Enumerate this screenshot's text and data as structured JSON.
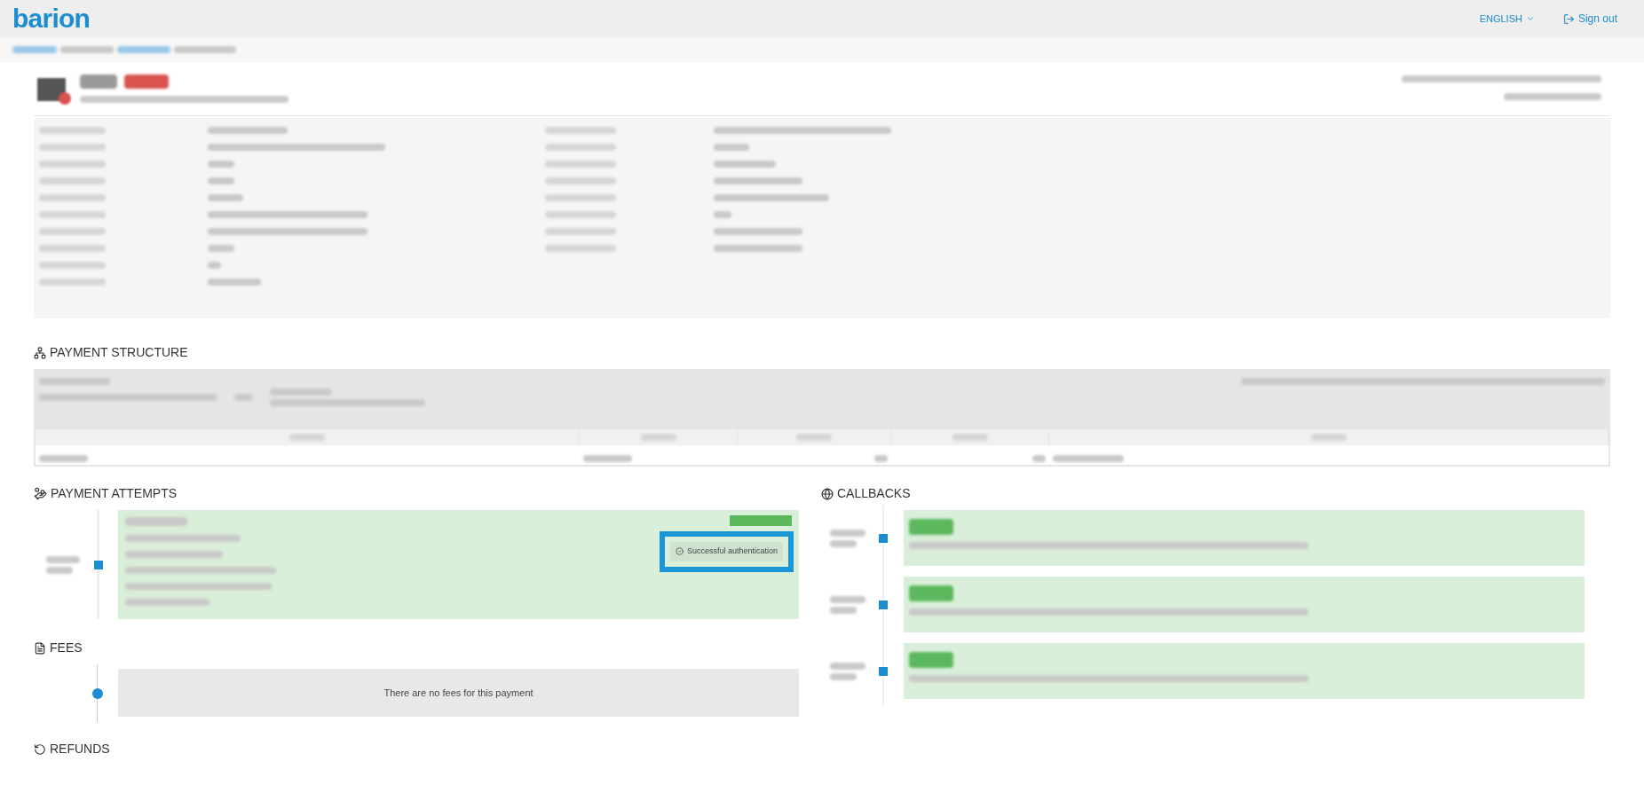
{
  "header": {
    "logo": "barion",
    "language": "ENGLISH",
    "sign_out": "Sign out"
  },
  "payment_structure": {
    "title": "PAYMENT STRUCTURE"
  },
  "payment_attempts": {
    "title": "PAYMENT ATTEMPTS",
    "attempts": [
      {
        "auth_status": "Successful authentication",
        "highlighted": true
      }
    ]
  },
  "callbacks": {
    "title": "CALLBACKS"
  },
  "fees": {
    "title": "FEES",
    "empty_text": "There are no fees for this payment"
  },
  "refunds": {
    "title": "REFUNDS"
  }
}
